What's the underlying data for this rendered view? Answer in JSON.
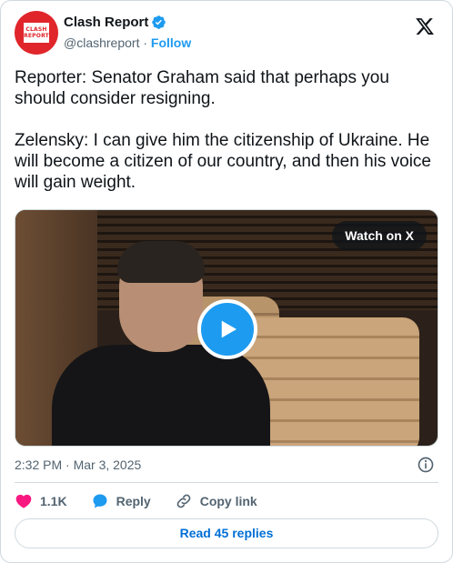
{
  "author": {
    "name": "Clash Report",
    "handle": "@clashreport",
    "separator": "·",
    "follow_label": "Follow",
    "avatar_text_line1": "CLASH",
    "avatar_text_line2": "REPORT",
    "avatar_color": "#e0262b",
    "verified_color": "#1d9bf0"
  },
  "post": {
    "text": "Reporter: Senator Graham said that perhaps you should consider resigning.\n\nZelensky: I can give him the citizenship of Ukraine. He will become a citizen of our country, and then his voice will gain weight.",
    "timestamp": "2:32 PM · Mar 3, 2025"
  },
  "media": {
    "watch_label": "Watch on X",
    "play_icon": "play-icon"
  },
  "actions": {
    "likes": "1.1K",
    "reply_label": "Reply",
    "copy_link_label": "Copy link"
  },
  "replies_button": "Read 45 replies",
  "colors": {
    "accent": "#1d9bf0",
    "like": "#f91880",
    "link": "#006fd6",
    "secondary_text": "#536471",
    "border": "#cfd9de"
  }
}
